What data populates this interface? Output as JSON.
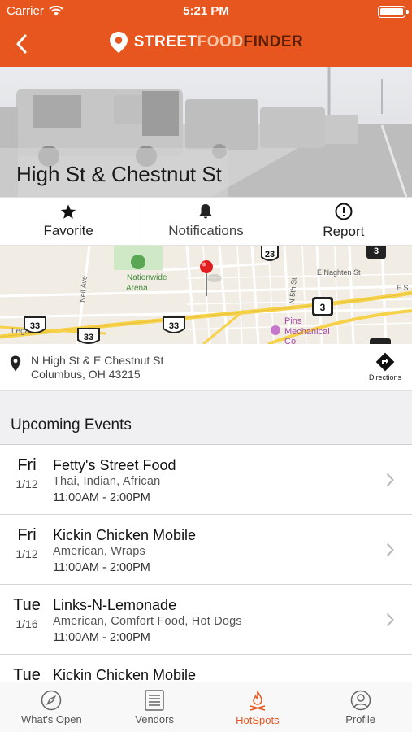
{
  "status_bar": {
    "carrier": "Carrier",
    "time": "5:21 PM"
  },
  "header": {
    "brand_part1": "STREET",
    "brand_part2": "FOOD",
    "brand_part3": "FINDER",
    "colors": {
      "primary": "#e8561f",
      "brand_dark": "#5a1e00",
      "brand_light": "#f7c7a7"
    }
  },
  "hero": {
    "title": "High St & Chestnut St"
  },
  "actions": [
    {
      "label": "Favorite",
      "icon": "star-icon"
    },
    {
      "label": "Notifications",
      "icon": "bell-icon"
    },
    {
      "label": "Report",
      "icon": "alert-icon"
    }
  ],
  "map": {
    "labels": {
      "arena_line1": "Nationwide",
      "arena_line2": "Arena",
      "neil_ave": "Neil Ave",
      "e_naghten": "E Naghten St",
      "n_5th": "N 5th St",
      "pins_line1": "Pins",
      "pins_line2": "Mechanical",
      "pins_line3": "Co.",
      "legal": "Legal",
      "e_s": "E S",
      "route_23": "23",
      "route_3": "3",
      "route_33": "33"
    }
  },
  "address": {
    "line1": "N High St & E Chestnut St",
    "line2": "Columbus, OH 43215",
    "directions_label": "Directions"
  },
  "upcoming": {
    "title": "Upcoming Events",
    "events": [
      {
        "day": "Fri",
        "date": "1/12",
        "name": "Fetty's Street Food",
        "categories": "Thai, Indian, African",
        "hours": "11:00AM - 2:00PM"
      },
      {
        "day": "Fri",
        "date": "1/12",
        "name": "Kickin Chicken Mobile",
        "categories": "American, Wraps",
        "hours": "11:00AM - 2:00PM"
      },
      {
        "day": "Tue",
        "date": "1/16",
        "name": "Links-N-Lemonade",
        "categories": "American, Comfort Food, Hot Dogs",
        "hours": "11:00AM - 2:00PM"
      },
      {
        "day": "Tue",
        "date": "",
        "name": "Kickin Chicken Mobile",
        "categories": "",
        "hours": ""
      }
    ]
  },
  "tabbar": {
    "active": "HotSpots",
    "tabs": [
      {
        "label": "What's Open",
        "icon": "compass-icon"
      },
      {
        "label": "Vendors",
        "icon": "list-icon"
      },
      {
        "label": "HotSpots",
        "icon": "fire-icon"
      },
      {
        "label": "Profile",
        "icon": "profile-icon"
      }
    ]
  }
}
